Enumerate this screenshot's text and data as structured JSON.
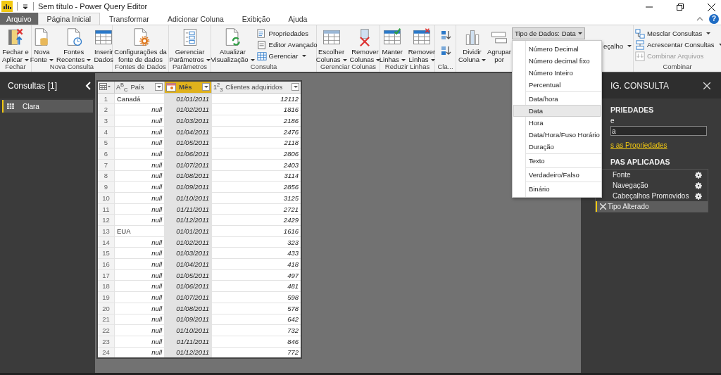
{
  "window": {
    "title": "Sem título - Power Query Editor",
    "help": "?"
  },
  "tabs": [
    {
      "label": "Arquivo",
      "kind": "file",
      "selected": false
    },
    {
      "label": "Página Inicial",
      "kind": "tab",
      "selected": true
    },
    {
      "label": "Transformar",
      "kind": "tab",
      "selected": false
    },
    {
      "label": "Adicionar Coluna",
      "kind": "tab",
      "selected": false
    },
    {
      "label": "Exibição",
      "kind": "tab",
      "selected": false
    },
    {
      "label": "Ajuda",
      "kind": "tab",
      "selected": false
    }
  ],
  "ribbon": {
    "groups": [
      {
        "label": "Fechar",
        "items": [
          {
            "kind": "large",
            "lines": [
              "Fechar e",
              "Aplicar"
            ],
            "dropdown": true
          }
        ]
      },
      {
        "label": "Nova Consulta",
        "items": [
          {
            "kind": "large",
            "lines": [
              "Nova",
              "Fonte"
            ],
            "dropdown": true
          },
          {
            "kind": "large",
            "lines": [
              "Fontes",
              "Recentes"
            ],
            "dropdown": true
          },
          {
            "kind": "large",
            "lines": [
              "Inserir",
              "Dados"
            ],
            "dropdown": false
          }
        ]
      },
      {
        "label": "Fontes de Dados",
        "items": [
          {
            "kind": "large",
            "lines": [
              "Configurações da",
              "fonte de dados"
            ],
            "dropdown": false
          }
        ]
      },
      {
        "label": "Parâmetros",
        "items": [
          {
            "kind": "large",
            "lines": [
              "Gerenciar",
              "Parâmetros"
            ],
            "dropdown": true
          }
        ]
      },
      {
        "label": "Consulta",
        "items": [
          {
            "kind": "large",
            "lines": [
              "Atualizar",
              "Visualização"
            ],
            "dropdown": true
          },
          {
            "kind": "small",
            "lines": [
              "Propriedades"
            ],
            "dropdown": false
          },
          {
            "kind": "small",
            "lines": [
              "Editor Avançado"
            ],
            "dropdown": false
          },
          {
            "kind": "small",
            "lines": [
              "Gerenciar"
            ],
            "dropdown": true
          }
        ]
      },
      {
        "label": "Gerenciar Colunas",
        "items": [
          {
            "kind": "large",
            "lines": [
              "Escolher",
              "Colunas"
            ],
            "dropdown": true
          },
          {
            "kind": "large",
            "lines": [
              "Remover",
              "Colunas"
            ],
            "dropdown": true
          }
        ]
      },
      {
        "label": "Reduzir Linhas",
        "items": [
          {
            "kind": "large",
            "lines": [
              "Manter",
              "Linhas"
            ],
            "dropdown": true
          },
          {
            "kind": "large",
            "lines": [
              "Remover",
              "Linhas"
            ],
            "dropdown": true
          }
        ]
      },
      {
        "label": "Cla...",
        "items": [
          {
            "kind": "icon"
          },
          {
            "kind": "icon"
          }
        ]
      },
      {
        "items": [
          {
            "kind": "large",
            "lines": [
              "Dividir",
              "Coluna"
            ],
            "dropdown": true
          },
          {
            "kind": "large",
            "lines": [
              "Agrupar",
              "por"
            ],
            "dropdown": false
          },
          {
            "kind": "menu-button",
            "lines": [
              "Tipo de Dados: Data"
            ],
            "dropdown": true,
            "expanded": true
          },
          {
            "kind": "small",
            "lines": [
              "eçalho"
            ],
            "dropdown": true
          }
        ]
      },
      {
        "label": "Combinar",
        "items": [
          {
            "kind": "small",
            "lines": [
              "Mesclar Consultas"
            ],
            "dropdown": true
          },
          {
            "kind": "small",
            "lines": [
              "Acrescentar Consultas"
            ],
            "dropdown": true
          },
          {
            "kind": "small",
            "lines": [
              "Combinar Arquivos"
            ],
            "dropdown": false,
            "disabled": true
          }
        ]
      }
    ]
  },
  "type_menu": {
    "sections": [
      [
        {
          "label": "Número Decimal",
          "selected": false
        },
        {
          "label": "Número decimal fixo",
          "selected": false
        },
        {
          "label": "Número Inteiro",
          "selected": false
        },
        {
          "label": "Percentual",
          "selected": false
        }
      ],
      [
        {
          "label": "Data/hora",
          "selected": false
        },
        {
          "label": "Data",
          "selected": true
        },
        {
          "label": "Hora",
          "selected": false
        },
        {
          "label": "Data/Hora/Fuso Horário",
          "selected": false
        },
        {
          "label": "Duração",
          "selected": false
        }
      ],
      [
        {
          "label": "Texto",
          "selected": false
        }
      ],
      [
        {
          "label": "Verdadeiro/Falso",
          "selected": false
        }
      ],
      [
        {
          "label": "Binário",
          "selected": false
        }
      ]
    ]
  },
  "queries_panel": {
    "title": "Consultas [1]",
    "items": [
      {
        "label": "Clara",
        "selected": true
      }
    ]
  },
  "table": {
    "columns": [
      {
        "name": "País",
        "kind": "text",
        "type_label": "A$^{B}$$_{C}$",
        "selected": false
      },
      {
        "name": "Mês",
        "kind": "date",
        "selected": true
      },
      {
        "name": "Clientes adquiridos",
        "kind": "number",
        "type_label": "1$^{2}$$_{3}$",
        "selected": false
      }
    ],
    "rows": [
      {
        "num": "1",
        "pais": "Canadá",
        "pais_null": false,
        "mes": "01/01/2011",
        "clientes": "12112"
      },
      {
        "num": "2",
        "pais": "null",
        "pais_null": true,
        "mes": "01/02/2011",
        "clientes": "1816"
      },
      {
        "num": "3",
        "pais": "null",
        "pais_null": true,
        "mes": "01/03/2011",
        "clientes": "2186"
      },
      {
        "num": "4",
        "pais": "null",
        "pais_null": true,
        "mes": "01/04/2011",
        "clientes": "2476"
      },
      {
        "num": "5",
        "pais": "null",
        "pais_null": true,
        "mes": "01/05/2011",
        "clientes": "2118"
      },
      {
        "num": "6",
        "pais": "null",
        "pais_null": true,
        "mes": "01/06/2011",
        "clientes": "2806"
      },
      {
        "num": "7",
        "pais": "null",
        "pais_null": true,
        "mes": "01/07/2011",
        "clientes": "2403"
      },
      {
        "num": "8",
        "pais": "null",
        "pais_null": true,
        "mes": "01/08/2011",
        "clientes": "3114"
      },
      {
        "num": "9",
        "pais": "null",
        "pais_null": true,
        "mes": "01/09/2011",
        "clientes": "2856"
      },
      {
        "num": "10",
        "pais": "null",
        "pais_null": true,
        "mes": "01/10/2011",
        "clientes": "3125"
      },
      {
        "num": "11",
        "pais": "null",
        "pais_null": true,
        "mes": "01/11/2011",
        "clientes": "2721"
      },
      {
        "num": "12",
        "pais": "null",
        "pais_null": true,
        "mes": "01/12/2011",
        "clientes": "2429"
      },
      {
        "num": "13",
        "pais": "EUA",
        "pais_null": false,
        "mes": "01/01/2011",
        "clientes": "1616"
      },
      {
        "num": "14",
        "pais": "null",
        "pais_null": true,
        "mes": "01/02/2011",
        "clientes": "323"
      },
      {
        "num": "15",
        "pais": "null",
        "pais_null": true,
        "mes": "01/03/2011",
        "clientes": "433"
      },
      {
        "num": "16",
        "pais": "null",
        "pais_null": true,
        "mes": "01/04/2011",
        "clientes": "418"
      },
      {
        "num": "17",
        "pais": "null",
        "pais_null": true,
        "mes": "01/05/2011",
        "clientes": "497"
      },
      {
        "num": "18",
        "pais": "null",
        "pais_null": true,
        "mes": "01/06/2011",
        "clientes": "481"
      },
      {
        "num": "19",
        "pais": "null",
        "pais_null": true,
        "mes": "01/07/2011",
        "clientes": "598"
      },
      {
        "num": "20",
        "pais": "null",
        "pais_null": true,
        "mes": "01/08/2011",
        "clientes": "578"
      },
      {
        "num": "21",
        "pais": "null",
        "pais_null": true,
        "mes": "01/09/2011",
        "clientes": "642"
      },
      {
        "num": "22",
        "pais": "null",
        "pais_null": true,
        "mes": "01/10/2011",
        "clientes": "732"
      },
      {
        "num": "23",
        "pais": "null",
        "pais_null": true,
        "mes": "01/11/2011",
        "clientes": "846"
      },
      {
        "num": "24",
        "pais": "null",
        "pais_null": true,
        "mes": "01/12/2011",
        "clientes": "772"
      }
    ]
  },
  "query_settings": {
    "title": "IG. CONSULTA",
    "properties_heading": "PRIEDADES",
    "name_label": "e",
    "name_value": "a",
    "all_properties_link": "s as Propriedades",
    "steps_heading": "PAS APLICADAS",
    "steps": [
      {
        "label": "Fonte",
        "has_settings": true,
        "selected": false
      },
      {
        "label": "Navegação",
        "has_settings": true,
        "selected": false
      },
      {
        "label": "Cabeçalhos Promovidos",
        "has_settings": true,
        "selected": false
      },
      {
        "label": "Tipo Alterado",
        "has_settings": false,
        "selected": true
      }
    ]
  }
}
